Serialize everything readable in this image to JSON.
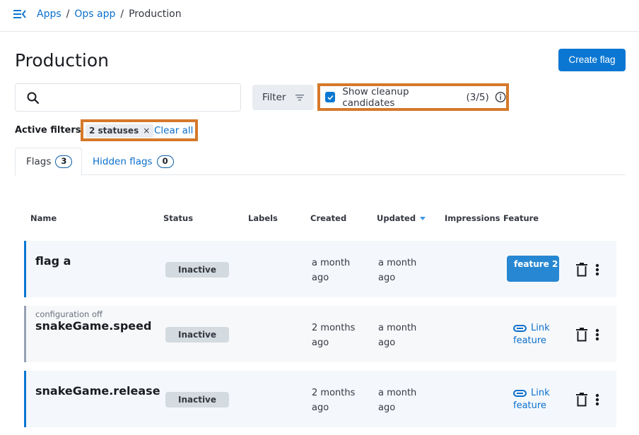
{
  "breadcrumb": {
    "items": [
      "Apps",
      "Ops app"
    ],
    "separator": "/",
    "current": "Production"
  },
  "page": {
    "title": "Production",
    "create_button": "Create flag"
  },
  "search": {
    "placeholder": "",
    "value": ""
  },
  "filter_button": "Filter",
  "cleanup": {
    "label": "Show cleanup candidates",
    "count": "(3/5)",
    "checked": true
  },
  "active_filters": {
    "label": "Active filters:",
    "chips": [
      "2 statuses"
    ],
    "chip_remove": "×",
    "clear_all": "Clear all"
  },
  "tabs": [
    {
      "label": "Flags",
      "count": "3",
      "active": true
    },
    {
      "label": "Hidden flags",
      "count": "0",
      "active": false
    }
  ],
  "table": {
    "columns": [
      "Name",
      "Status",
      "Labels",
      "Created",
      "Updated",
      "Impressions",
      "Feature"
    ],
    "sorted_by": "Updated",
    "rows": [
      {
        "subtitle": "",
        "name": "flag a",
        "status": "Inactive",
        "created_1": "a month",
        "created_2": "ago",
        "updated_1": "a month",
        "updated_2": "ago",
        "feature": "feature 2",
        "feature_linked": true
      },
      {
        "subtitle": "configuration off",
        "name": "snakeGame.speed",
        "status": "Inactive",
        "created_1": "2 months",
        "created_2": "ago",
        "updated_1": "a month",
        "updated_2": "ago",
        "feature_link_1": "Link",
        "feature_link_2": "feature",
        "feature_linked": false
      },
      {
        "subtitle": "",
        "name": "snakeGame.release",
        "status": "Inactive",
        "created_1": "2 months",
        "created_2": "ago",
        "updated_1": "a month",
        "updated_2": "ago",
        "feature_link_1": "Link",
        "feature_link_2": "feature",
        "feature_linked": false
      }
    ]
  },
  "colors": {
    "accent": "#0b77d2",
    "highlight": "#d5792b",
    "row_bg": "#f4f8fc"
  }
}
